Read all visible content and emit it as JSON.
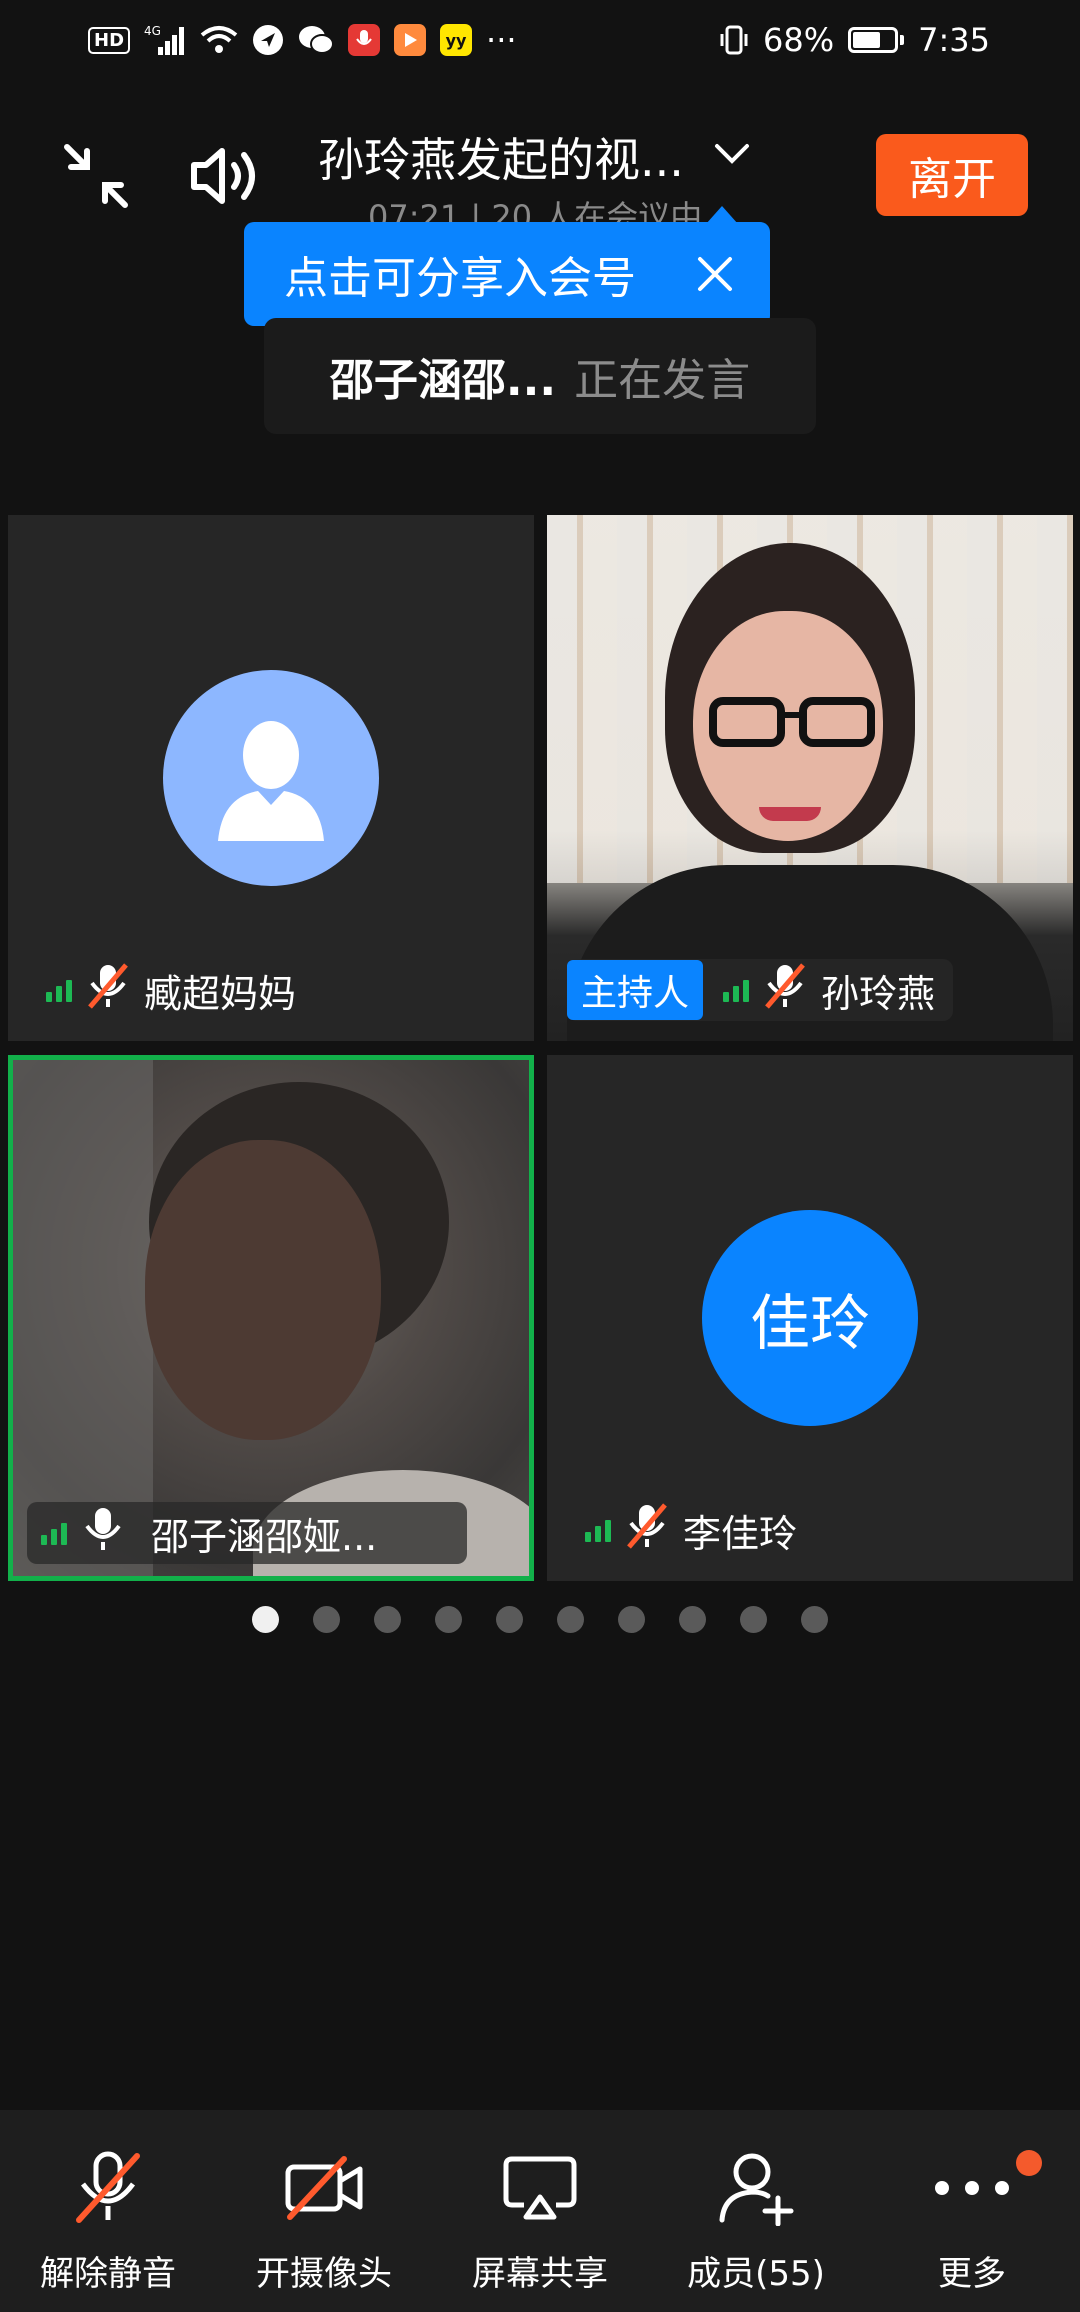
{
  "status_bar": {
    "hd": "HD",
    "network": "4G",
    "more_indicator": "···",
    "battery_percent": "68%",
    "battery_level": 0.68,
    "time": "7:35"
  },
  "header": {
    "title": "孙玲燕发起的视...",
    "subtitle": "07:21 | 20 人在会议中",
    "leave_label": "离开"
  },
  "tooltip": {
    "text": "点击可分享入会号"
  },
  "speaking": {
    "name": "邵子涵邵...",
    "state": "正在发言"
  },
  "tiles": [
    {
      "name": "臧超妈妈",
      "muted": true,
      "avatar_type": "person-icon",
      "avatar_color": "#8db7ff"
    },
    {
      "name": "孙玲燕",
      "muted": true,
      "host_badge": "主持人",
      "video": true
    },
    {
      "name": "邵子涵邵娅...",
      "muted": false,
      "video": true,
      "speaking": true
    },
    {
      "name": "李佳玲",
      "muted": true,
      "avatar_text": "佳玲",
      "avatar_color": "#0a84ff"
    }
  ],
  "pagination": {
    "total": 10,
    "current": 1
  },
  "toolbar": {
    "unmute_label": "解除静音",
    "camera_label": "开摄像头",
    "share_label": "屏幕共享",
    "members_label": "成员(55)",
    "more_label": "更多"
  },
  "colors": {
    "accent": "#0a84ff",
    "leave": "#fa5a1c",
    "active_border": "#12b04a",
    "mute_slash": "#ff5a2d"
  }
}
